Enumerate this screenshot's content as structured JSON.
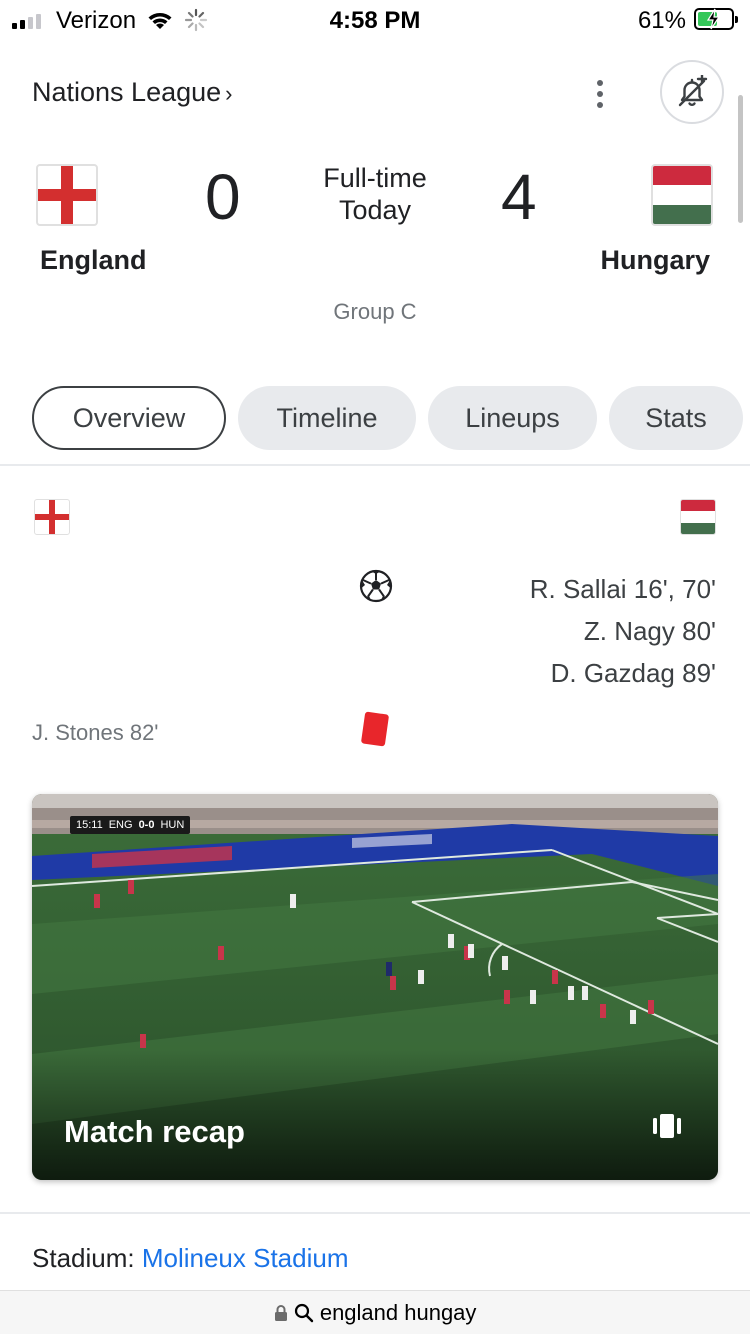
{
  "status_bar": {
    "carrier": "Verizon",
    "time": "4:58 PM",
    "battery_percent": "61%",
    "battery_level": 0.61,
    "signal_bars": 2
  },
  "header": {
    "league": "Nations League",
    "league_chevron": "›",
    "icons": [
      "more-vert-icon",
      "bell-plus-icon"
    ]
  },
  "match": {
    "home": {
      "name": "England",
      "score": "0",
      "flag": "england-flag"
    },
    "away": {
      "name": "Hungary",
      "score": "4",
      "flag": "hungary-flag"
    },
    "status_line1": "Full-time",
    "status_line2": "Today",
    "group": "Group C"
  },
  "tabs": [
    {
      "label": "Overview",
      "active": true
    },
    {
      "label": "Timeline",
      "active": false
    },
    {
      "label": "Lineups",
      "active": false
    },
    {
      "label": "Stats",
      "active": false
    }
  ],
  "events": {
    "goals_away": [
      "R. Sallai 16', 70'",
      "Z. Nagy 80'",
      "D. Gazdag 89'"
    ],
    "red_cards_home": [
      "J. Stones 82'"
    ]
  },
  "video": {
    "title": "Match recap",
    "scorebug": {
      "clock": "15:11",
      "home": "ENG",
      "score": "0-0",
      "away": "HUN"
    },
    "icon": "shorts-icon"
  },
  "stadium": {
    "label": "Stadium:",
    "value": "Molineux Stadium"
  },
  "browser": {
    "url": "england hungay"
  },
  "colors": {
    "link": "#1a73e8",
    "red_card": "#e8262b",
    "tab_inactive_bg": "#e8eaed"
  }
}
